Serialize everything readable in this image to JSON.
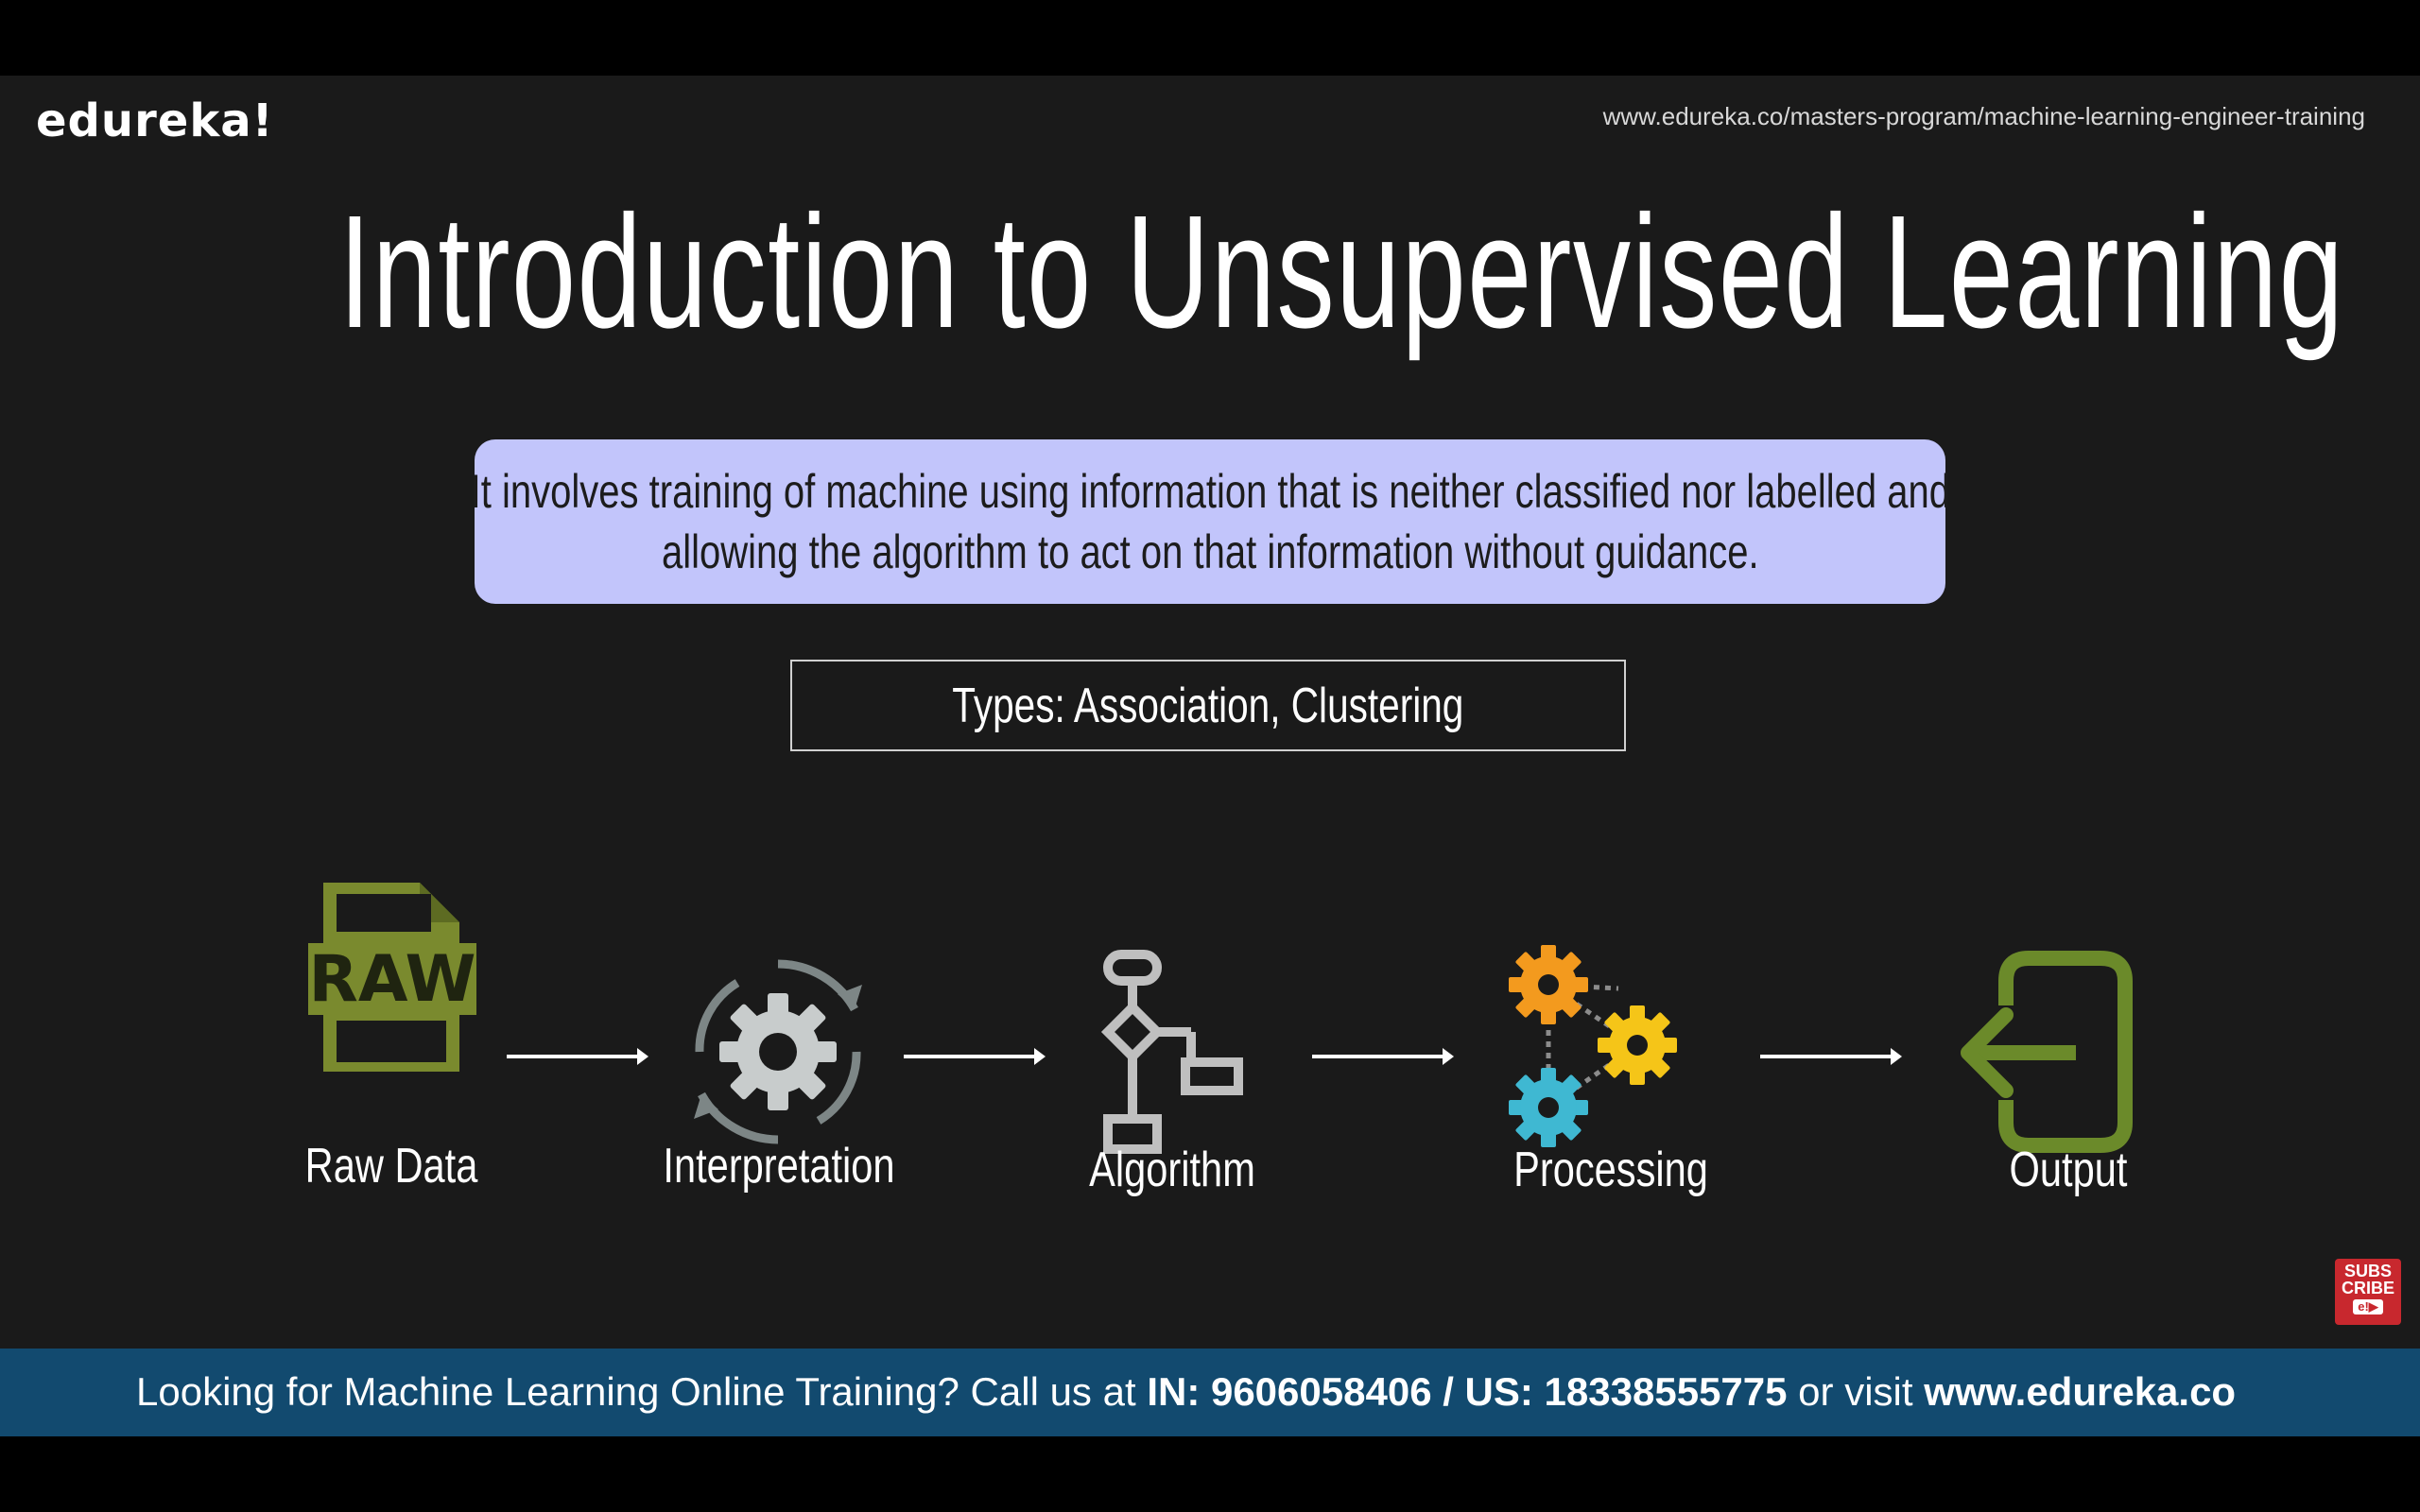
{
  "header": {
    "brand": "edureka!",
    "url": "www.edureka.co/masters-program/machine-learning-engineer-training"
  },
  "slide": {
    "title": "Introduction to Unsupervised Learning",
    "description_line1": "It involves training of machine using information that is neither classified nor labelled and",
    "description_line2": "allowing the algorithm to act on that information without guidance.",
    "types": "Types: Association, Clustering"
  },
  "flow": {
    "steps": [
      {
        "label": "Raw Data",
        "icon": "raw-file-icon",
        "badge": "RAW"
      },
      {
        "label": "Interpretation",
        "icon": "gear-refresh-icon"
      },
      {
        "label": "Algorithm",
        "icon": "flowchart-icon"
      },
      {
        "label": "Processing",
        "icon": "gears-network-icon"
      },
      {
        "label": "Output",
        "icon": "exit-door-icon"
      }
    ]
  },
  "banner": {
    "prefix": "Looking for Machine Learning Online Training? Call us at ",
    "phones": "IN: 9606058406 / US: 18338555775",
    "middle": " or visit ",
    "site": "www.edureka.co"
  },
  "subscribe": {
    "line1": "SUBS",
    "line2": "CRIBE",
    "play": "e!▶"
  },
  "colors": {
    "background": "#1a1a1a",
    "description_box": "#c2c5fb",
    "banner": "#124a6f",
    "raw_icon": "#7a8a2e",
    "gear_gray": "#c8cccc",
    "gear_orange": "#f39a1e",
    "gear_yellow": "#f5c518",
    "gear_blue": "#3fb8d2",
    "output_icon": "#6b8a2a"
  }
}
